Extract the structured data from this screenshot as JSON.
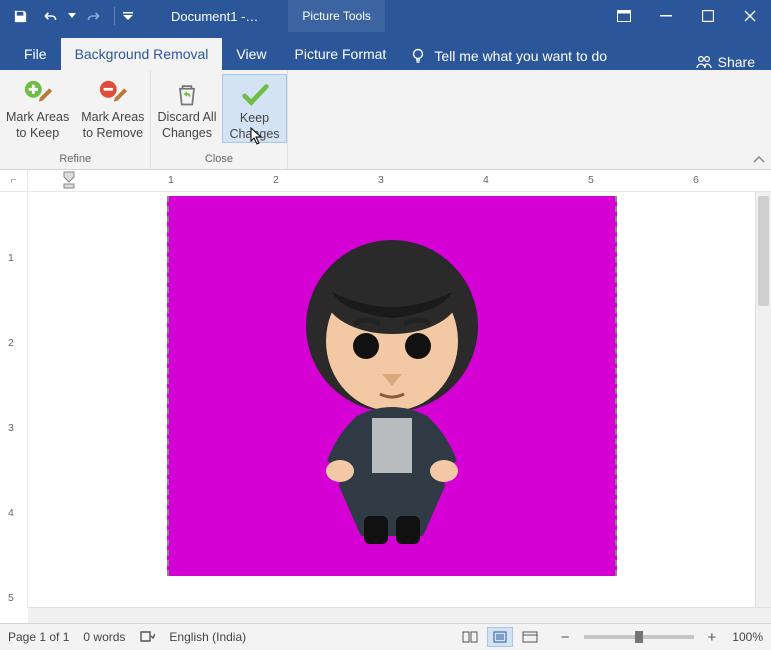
{
  "titlebar": {
    "doc_title": "Document1  -…",
    "context_tab": "Picture Tools"
  },
  "tabs": {
    "file": "File",
    "bgremoval": "Background Removal",
    "view": "View",
    "picformat": "Picture Format",
    "tellme": "Tell me what you want to do",
    "share": "Share"
  },
  "ribbon": {
    "mark_keep_l1": "Mark Areas",
    "mark_keep_l2": "to Keep",
    "mark_remove_l1": "Mark Areas",
    "mark_remove_l2": "to Remove",
    "discard_l1": "Discard All",
    "discard_l2": "Changes",
    "keep_l1": "Keep",
    "keep_l2": "Changes",
    "group_refine": "Refine",
    "group_close": "Close"
  },
  "ruler_h": [
    "1",
    "2",
    "3",
    "4",
    "5",
    "6"
  ],
  "ruler_v": [
    "1",
    "2",
    "3",
    "4",
    "5"
  ],
  "status": {
    "page": "Page 1 of 1",
    "words": "0 words",
    "lang": "English (India)",
    "zoom": "100%"
  }
}
